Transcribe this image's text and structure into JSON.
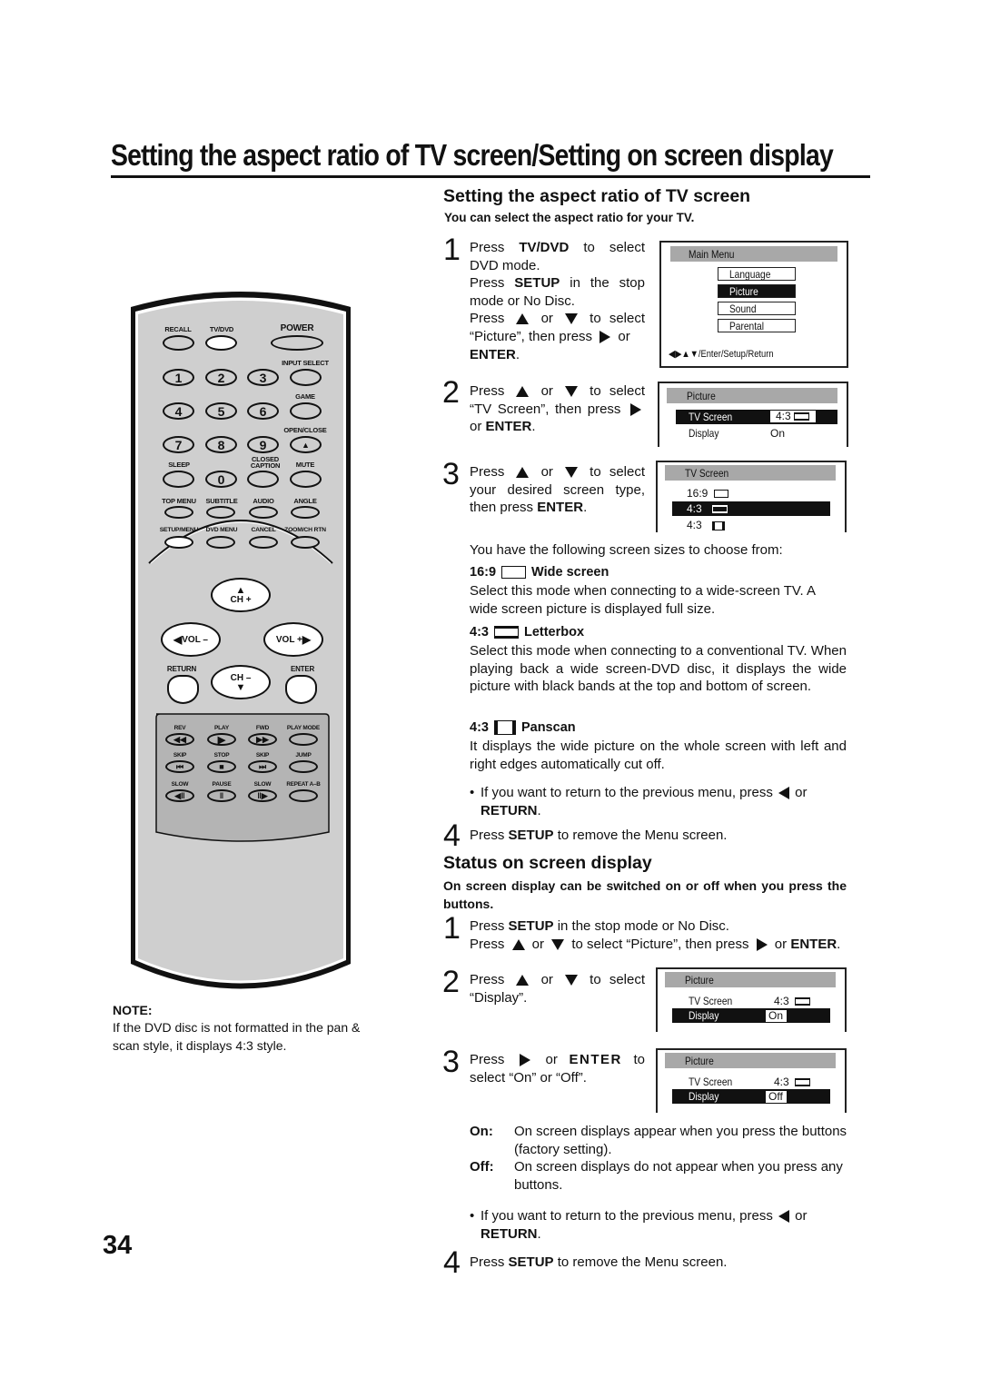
{
  "page": {
    "title": "Setting the aspect ratio of TV screen/Setting on screen display",
    "page_number": "34"
  },
  "note": {
    "label": "NOTE:",
    "text": "If the DVD disc is not formatted in the pan & scan style, it displays 4:3 style."
  },
  "remote": {
    "labels": {
      "recall": "RECALL",
      "tvdvd": "TV/DVD",
      "power": "POWER",
      "input_select": "INPUT SELECT",
      "game": "GAME",
      "open_close": "OPEN/CLOSE",
      "sleep": "SLEEP",
      "closed_caption_1": "CLOSED",
      "closed_caption_2": "CAPTION",
      "mute": "MUTE",
      "top_menu": "TOP MENU",
      "subtitle": "SUBTITLE",
      "audio": "AUDIO",
      "angle": "ANGLE",
      "setup_menu": "SETUP/MENU",
      "dvd_menu": "DVD MENU",
      "cancel": "CANCEL",
      "zoom_ch_rtn": "ZOOM/CH RTN",
      "ch_plus": "CH +",
      "ch_minus": "CH –",
      "vol_minus": "VOL –",
      "vol_plus": "VOL +",
      "return": "RETURN",
      "enter": "ENTER",
      "rev": "REV",
      "play": "PLAY",
      "fwd": "FWD",
      "play_mode": "PLAY MODE",
      "skip_back": "SKIP",
      "stop": "STOP",
      "skip_fwd": "SKIP",
      "jump": "JUMP",
      "slow_back": "SLOW",
      "pause": "PAUSE",
      "slow_fwd": "SLOW",
      "repeat_ab": "REPEAT A–B"
    },
    "digits": [
      "1",
      "2",
      "3",
      "4",
      "5",
      "6",
      "7",
      "8",
      "9",
      "0"
    ]
  },
  "aspect": {
    "heading": "Setting the aspect ratio of TV screen",
    "subheading": "You can select the aspect ratio for your TV.",
    "step1": {
      "num": "1",
      "l1a": "Press ",
      "l1b": "TV/DVD",
      "l1c": " to select DVD mode.",
      "l2a": "Press ",
      "l2b": "SETUP",
      "l2c": " in the stop mode or No Disc.",
      "l3a": "Press ",
      "l3b": " or ",
      "l3c": " to select “Picture”, then press ",
      "l3d": " or ",
      "l3e": "ENTER",
      "l3f": "."
    },
    "step2": {
      "num": "2",
      "a": "Press ",
      "b": " or ",
      "c": " to select “TV Screen”, then press ",
      "d": " or ",
      "e": "ENTER",
      "f": "."
    },
    "step3": {
      "num": "3",
      "a": "Press ",
      "b": " or ",
      "c": " to select your desired screen type, then press ",
      "d": "ENTER",
      "e": "."
    },
    "osd_main": {
      "header": "Main Menu",
      "items": [
        "Language",
        "Picture",
        "Sound",
        "Parental"
      ],
      "selected": "Picture",
      "footer": "◀▶▲▼/Enter/Setup/Return"
    },
    "osd_picture": {
      "header": "Picture",
      "rows": [
        {
          "label": "TV Screen",
          "value": "4:3"
        },
        {
          "label": "Display",
          "value": "On"
        }
      ]
    },
    "osd_tvscreen": {
      "header": "TV Screen",
      "options": [
        "16:9",
        "4:3",
        "4:3"
      ],
      "selected_index": 1
    },
    "intro": "You have the following screen sizes to choose from:",
    "sizes": [
      {
        "ratio": "16:9",
        "name": "Wide screen",
        "icon": "widescreen-icon",
        "text": "Select this mode when connecting to a wide-screen TV. A wide screen picture is displayed full size."
      },
      {
        "ratio": "4:3",
        "name": "Letterbox",
        "icon": "letterbox-icon",
        "text": "Select this mode when connecting to a conventional TV. When playing back a wide screen-DVD disc, it displays the wide picture with black bands at the top and bottom of screen."
      },
      {
        "ratio": "4:3",
        "name": "Panscan",
        "icon": "panscan-icon",
        "text": "It displays the wide picture on the whole screen with left and right edges automatically cut off."
      }
    ],
    "bullet": {
      "a": "If you want to return to the previous menu, press ",
      "b": " or ",
      "c": "RETURN",
      "d": "."
    },
    "step4": {
      "num": "4",
      "a": "Press ",
      "b": "SETUP",
      "c": " to remove the Menu screen."
    }
  },
  "status": {
    "heading": "Status on screen display",
    "subheading": "On screen display can be switched on or off when you press the buttons.",
    "step1": {
      "num": "1",
      "l1a": "Press ",
      "l1b": "SETUP",
      "l1c": " in the stop mode or No Disc.",
      "l2a": "Press ",
      "l2b": " or ",
      "l2c": " to select  “Picture”, then press ",
      "l2d": " or ",
      "l2e": "ENTER",
      "l2f": "."
    },
    "step2": {
      "num": "2",
      "a": "Press ",
      "b": " or ",
      "c": " to select “Display”."
    },
    "step3": {
      "num": "3",
      "a": "Press ",
      "b": " or ",
      "c": "ENTER",
      "d": " to select  “On” or “Off”."
    },
    "osd_on": {
      "header": "Picture",
      "row1_label": "TV Screen",
      "row1_value": "4:3",
      "row2_label": "Display",
      "row2_value": "On"
    },
    "osd_off": {
      "header": "Picture",
      "row1_label": "TV Screen",
      "row1_value": "4:3",
      "row2_label": "Display",
      "row2_value": "Off"
    },
    "defs": [
      {
        "term": "On:",
        "text": "On screen displays appear when you press the buttons (factory setting)."
      },
      {
        "term": "Off:",
        "text": "On screen displays do not appear when you press any buttons."
      }
    ],
    "bullet": {
      "a": "If you want to return to the previous menu, press ",
      "b": " or ",
      "c": "RETURN",
      "d": "."
    },
    "step4": {
      "num": "4",
      "a": "Press ",
      "b": "SETUP",
      "c": " to remove the Menu screen."
    }
  }
}
